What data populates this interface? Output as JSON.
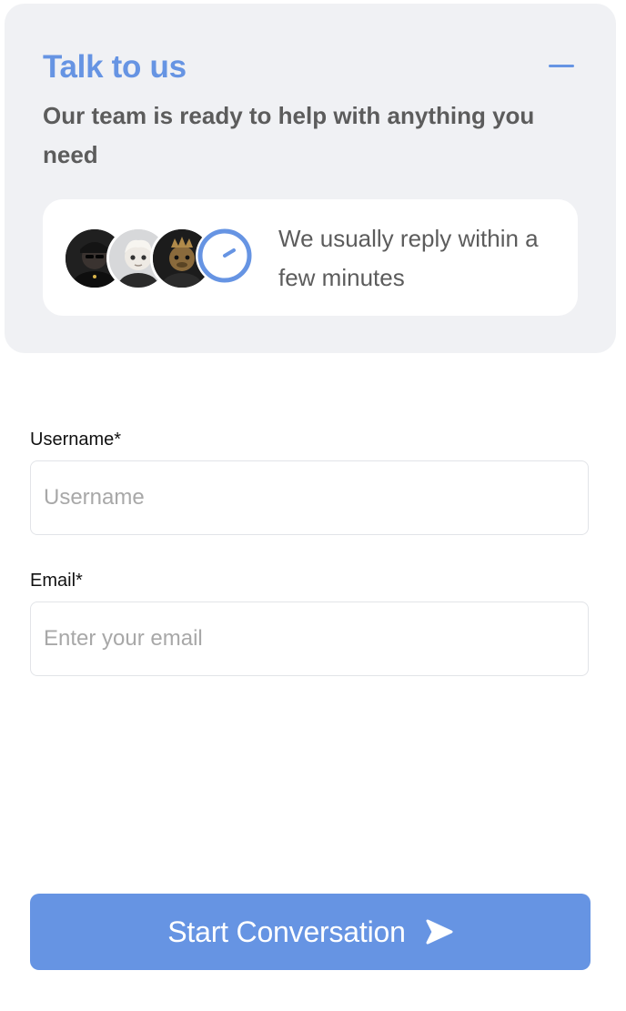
{
  "header": {
    "title": "Talk to us",
    "subtitle": "Our team is ready to help with anything you need",
    "minimize_icon": "minus-icon"
  },
  "reply_card": {
    "text": "We usually reply within a few minutes",
    "clock_icon": "clock-icon"
  },
  "form": {
    "username": {
      "label": "Username*",
      "placeholder": "Username",
      "value": ""
    },
    "email": {
      "label": "Email*",
      "placeholder": "Enter your email",
      "value": ""
    },
    "submit_label": "Start Conversation",
    "submit_icon": "send-icon"
  },
  "colors": {
    "accent": "#6694e3",
    "header_bg": "#f0f1f4",
    "muted_text": "#5c5c5c",
    "placeholder": "#a8a8a8"
  }
}
